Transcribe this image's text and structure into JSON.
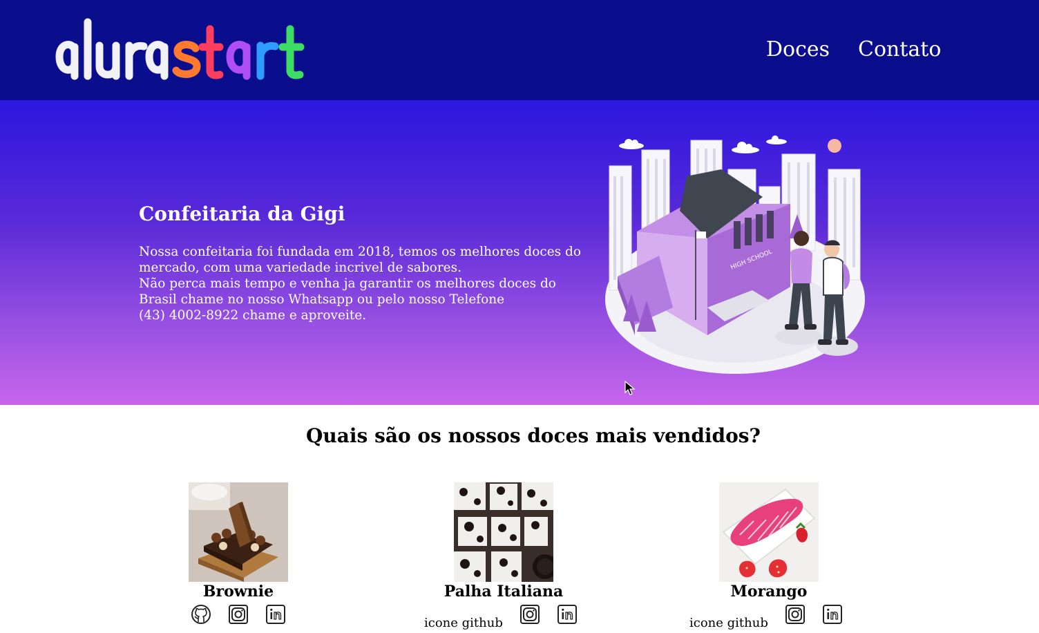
{
  "header": {
    "logo_text": "alurastart",
    "nav": [
      {
        "label": "Doces"
      },
      {
        "label": "Contato"
      }
    ]
  },
  "hero": {
    "title": "Confeitaria da Gigi",
    "lines": [
      "Nossa confeitaria foi fundada em 2018, temos os melhores doces do",
      "mercado, com uma variedade incrivel de sabores.",
      "Não perca mais tempo e venha ja garantir os melhores doces do",
      "Brasil chame no nosso Whatsapp ou pelo nosso Telefone",
      "(43) 4002-8922 chame e aproveite."
    ],
    "illustration_sign": "HIGH SCHOOL"
  },
  "products": {
    "title": "Quais são os nossos doces mais vendidos?",
    "items": [
      {
        "name": "Brownie",
        "icons": [
          "github-icon",
          "instagram-icon",
          "linkedin-icon"
        ]
      },
      {
        "name": "Palha Italiana",
        "github_alt": "icone github",
        "icons": [
          "instagram-icon",
          "linkedin-icon"
        ]
      },
      {
        "name": "Morango",
        "github_alt": "icone github",
        "icons": [
          "instagram-icon",
          "linkedin-icon"
        ]
      }
    ]
  },
  "colors": {
    "header_bg": "#0b0e8c",
    "hero_top": "#2b17de",
    "hero_bottom": "#c865ec"
  }
}
